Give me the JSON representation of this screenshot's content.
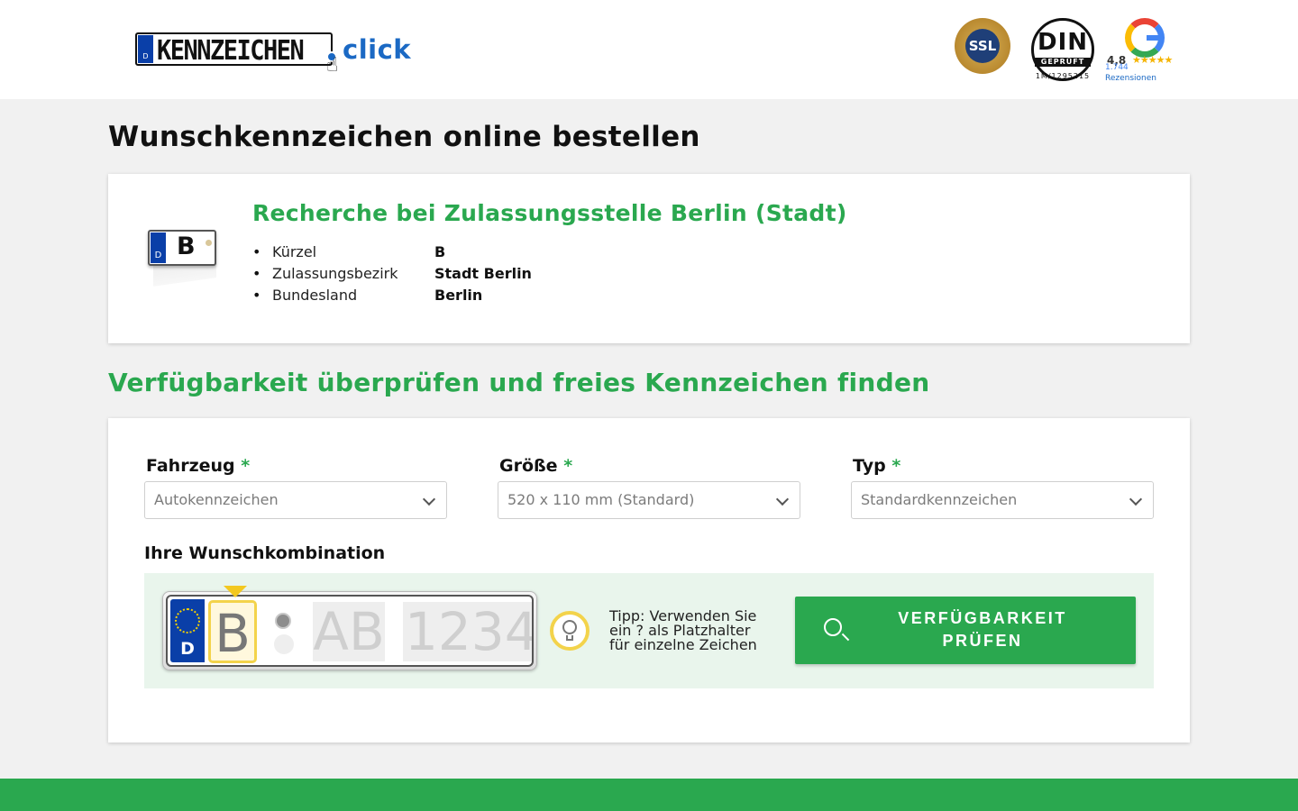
{
  "header": {
    "logo_plate_text": "KENNZEICHEN",
    "logo_country": "D",
    "logo_suffix": "click",
    "ssl_badge": "SSL",
    "din_badge": {
      "title": "DIN",
      "subtitle": "GEPRÜFT",
      "number": "1M/1295215"
    },
    "google": {
      "rating": "4,8",
      "stars": "★★★★★",
      "count": "1.744",
      "label": "Rezensionen"
    }
  },
  "page_title": "Wunschkennzeichen online bestellen",
  "office": {
    "title": "Recherche bei Zulassungsstelle Berlin (Stadt)",
    "plate_country": "D",
    "plate_letter": "B",
    "details": [
      {
        "key": "Kürzel",
        "value": "B"
      },
      {
        "key": "Zulassungsbezirk",
        "value": "Stadt Berlin"
      },
      {
        "key": "Bundesland",
        "value": "Berlin"
      }
    ]
  },
  "section_heading": "Verfügbarkeit überprüfen und freies Kennzeichen finden",
  "form": {
    "fahrzeug": {
      "label": "Fahrzeug",
      "required": "*",
      "value": "Autokennzeichen"
    },
    "groesse": {
      "label": "Größe",
      "required": "*",
      "value": "520 x 110 mm (Standard)"
    },
    "typ": {
      "label": "Typ",
      "required": "*",
      "value": "Standardkennzeichen"
    },
    "combo_label": "Ihre Wunschkombination",
    "plate": {
      "country": "D",
      "city": "B",
      "letters_placeholder": "AB",
      "numbers_placeholder": "1234"
    },
    "tip": "Tipp: Verwenden Sie ein ? als Platzhalter für einzelne Zeichen",
    "button_label": "VERFÜGBARKEIT PRÜFEN"
  },
  "colors": {
    "accent_green": "#2aa84f",
    "brand_blue": "#1b69c4",
    "eu_blue": "#0a3fa8",
    "highlight_yellow": "#f3d34b"
  },
  "icons": {
    "search": "search-icon",
    "tip": "lightbulb-icon",
    "select": "chevron-down-icon"
  }
}
